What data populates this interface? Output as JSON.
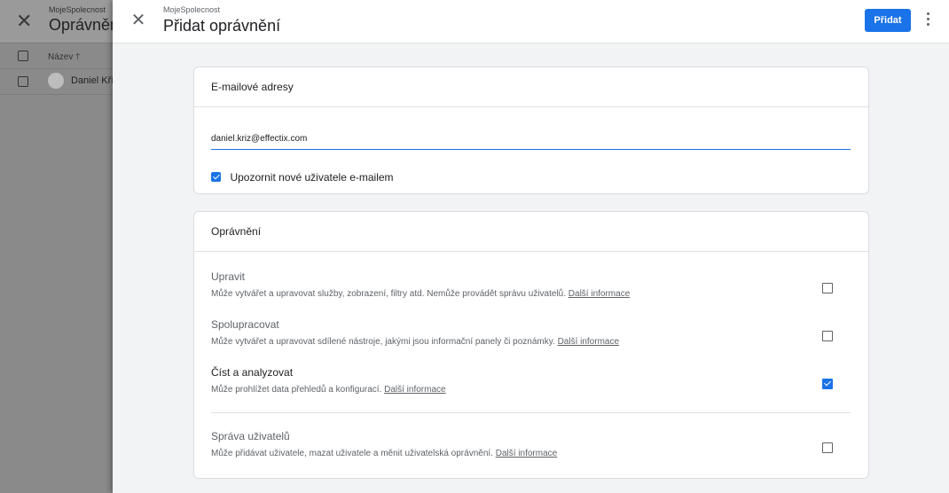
{
  "background": {
    "subtitle": "MojeSpolecnost",
    "title": "Oprávnění",
    "column_header": "Název",
    "sort_arrow": "🡑",
    "rows": [
      {
        "name": "Daniel Kříž"
      }
    ]
  },
  "header": {
    "close_glyph": "✕",
    "subtitle": "MojeSpolecnost",
    "title": "Přidat oprávnění",
    "add_label": "Přidat"
  },
  "emails": {
    "section_title": "E-mailové adresy",
    "input_value": "daniel.kriz@effectix.com",
    "notify_label": "Upozornit nové uživatele e-mailem",
    "notify_checked": true
  },
  "permissions": {
    "section_title": "Oprávnění",
    "items": [
      {
        "title": "Upravit",
        "desc": "Může vytvářet a upravovat služby, zobrazení, filtry atd. Nemůže provádět správu uživatelů.",
        "link": "Další informace",
        "checked": false
      },
      {
        "title": "Spolupracovat",
        "desc": "Může vytvářet a upravovat sdílené nástroje, jakými jsou informační panely či poznámky.",
        "link": "Další informace",
        "checked": false
      },
      {
        "title": "Číst a analyzovat",
        "desc": "Může prohlížet data přehledů a konfigurací.",
        "link": "Další informace",
        "checked": true
      },
      {
        "title": "Správa uživatelů",
        "desc": "Může přidávat uživatele, mazat uživatele a měnit uživatelská oprávnění.",
        "link": "Další informace",
        "checked": false
      }
    ]
  },
  "colors": {
    "accent": "#1a73e8",
    "overlay": "#8a8a8a"
  }
}
